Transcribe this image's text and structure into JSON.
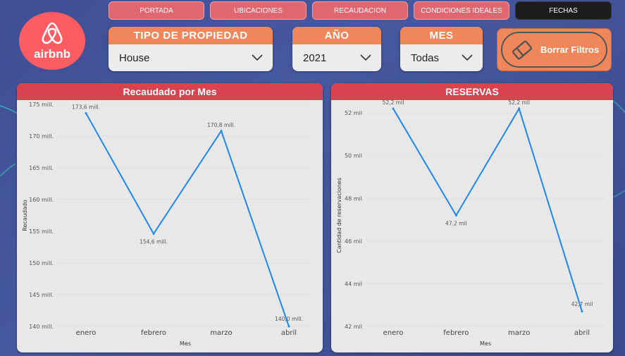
{
  "brand": {
    "name": "airbnb",
    "color": "#fd5c63"
  },
  "nav": {
    "items": [
      {
        "label": "PORTADA",
        "active": false
      },
      {
        "label": "UBICACIONES",
        "active": false
      },
      {
        "label": "RECAUDACION",
        "active": false
      },
      {
        "label": "CONDICIONES IDEALES",
        "active": false
      },
      {
        "label": "FECHAS",
        "active": true
      }
    ]
  },
  "filters": {
    "tipo": {
      "label": "TIPO DE PROPIEDAD",
      "value": "House"
    },
    "anio": {
      "label": "AÑO",
      "value": "2021"
    },
    "mes": {
      "label": "MES",
      "value": "Todas"
    }
  },
  "clear_button": {
    "label": "Borrar Filtros",
    "icon": "eraser-icon"
  },
  "colors": {
    "header_red": "#d9434f",
    "filter_orange": "#f0875b",
    "line": "#1e88ef"
  },
  "chart_data": [
    {
      "type": "line",
      "title": "Recaudado por Mes",
      "xlabel": "Mes",
      "ylabel": "Recaudado",
      "categories": [
        "enero",
        "febrero",
        "marzo",
        "abril"
      ],
      "values": [
        173.6,
        154.6,
        170.8,
        140.0
      ],
      "data_labels": [
        "173,6 mill.",
        "154,6 mill.",
        "170,8 mill.",
        "140,0 mill."
      ],
      "ylim": [
        140,
        175
      ],
      "yticks": [
        140,
        145,
        150,
        155,
        160,
        165,
        170,
        175
      ],
      "ytick_labels": [
        "140 mill.",
        "145 mill.",
        "150 mill.",
        "155 mill.",
        "160 mill.",
        "165 mill.",
        "170 mill.",
        "175 mill."
      ],
      "grid": true
    },
    {
      "type": "line",
      "title": "RESERVAS",
      "xlabel": "Mes",
      "ylabel": "Cantidad de reservaciones",
      "categories": [
        "enero",
        "febrero",
        "marzo",
        "abril"
      ],
      "values": [
        52.2,
        47.2,
        52.2,
        42.7
      ],
      "data_labels": [
        "52,2 mil",
        "47,2 mil",
        "52,2 mil",
        "42,7 mil"
      ],
      "ylim": [
        42,
        52.4
      ],
      "yticks": [
        42,
        44,
        46,
        48,
        50,
        52
      ],
      "ytick_labels": [
        "42 mil",
        "44 mil",
        "46 mil",
        "48 mil",
        "50 mil",
        "52 mil"
      ],
      "grid": true
    }
  ]
}
